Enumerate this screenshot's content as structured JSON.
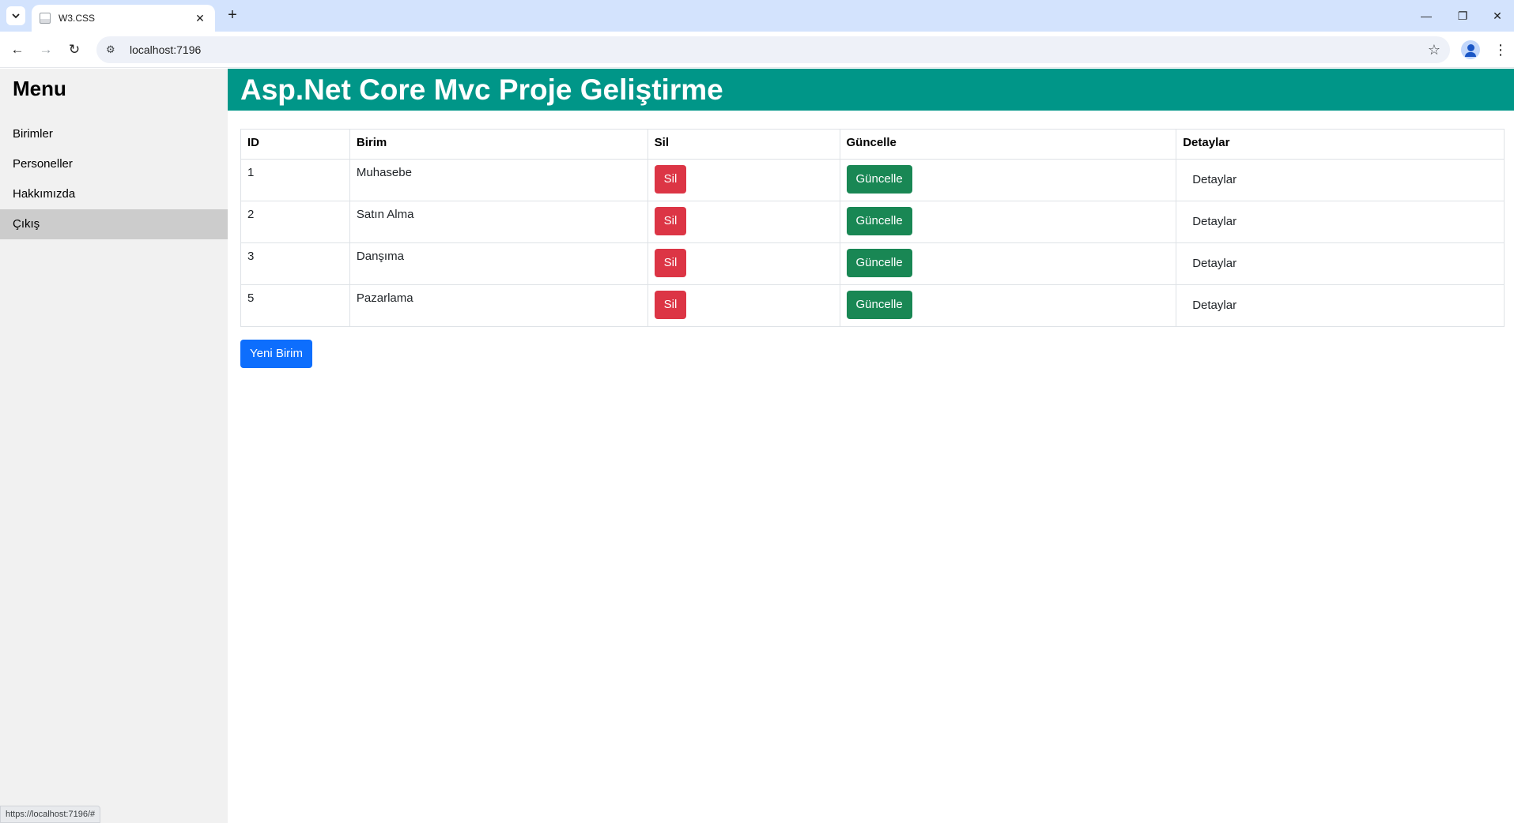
{
  "browser": {
    "tab_title": "W3.CSS",
    "url": "localhost:7196",
    "status_url": "https://localhost:7196/#"
  },
  "sidebar": {
    "title": "Menu",
    "items": [
      {
        "label": "Birimler"
      },
      {
        "label": "Personeller"
      },
      {
        "label": "Hakkımızda"
      },
      {
        "label": "Çıkış"
      }
    ]
  },
  "header": {
    "title": "Asp.Net Core Mvc Proje Geliştirme"
  },
  "table": {
    "columns": [
      "ID",
      "Birim",
      "Sil",
      "Güncelle",
      "Detaylar"
    ],
    "rows": [
      {
        "id": "1",
        "birim": "Muhasebe",
        "sil": "Sil",
        "guncelle": "Güncelle",
        "detaylar": "Detaylar"
      },
      {
        "id": "2",
        "birim": "Satın Alma",
        "sil": "Sil",
        "guncelle": "Güncelle",
        "detaylar": "Detaylar"
      },
      {
        "id": "3",
        "birim": "Danşıma",
        "sil": "Sil",
        "guncelle": "Güncelle",
        "detaylar": "Detaylar"
      },
      {
        "id": "5",
        "birim": "Pazarlama",
        "sil": "Sil",
        "guncelle": "Güncelle",
        "detaylar": "Detaylar"
      }
    ]
  },
  "actions": {
    "new_label": "Yeni Birim"
  },
  "colors": {
    "header": "#009688",
    "danger": "#dc3545",
    "success": "#198754",
    "primary": "#0d6efd",
    "sidebar": "#f1f1f1",
    "sidebar_active": "#cccccc"
  }
}
